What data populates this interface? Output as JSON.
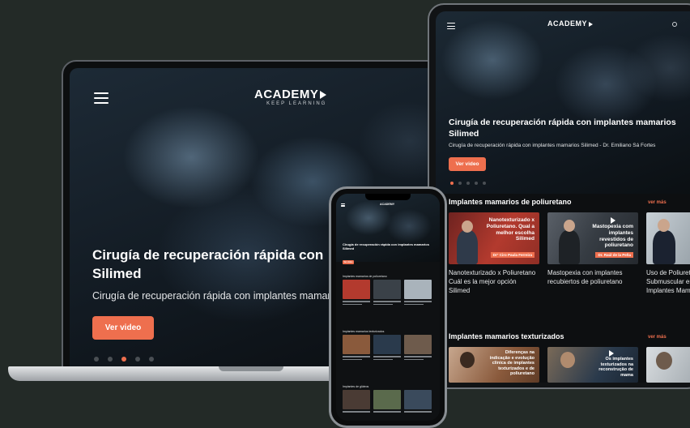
{
  "brand": {
    "logo_text": "ACADEMY",
    "logo_tagline": "KEEP LEARNING",
    "accent_color": "#ee6f4e"
  },
  "laptop": {
    "hero_title": "Cirugía de recuperación rápida con implantes mamarios Silimed",
    "hero_title_line1": "Cirugía de recuperación rápida con",
    "hero_title_line2": "Silimed",
    "hero_subtitle": "Cirugía de recuperación rápida con implantes mamarios",
    "cta_label": "Ver video",
    "carousel": {
      "total": 5,
      "active_index": 2
    }
  },
  "tablet": {
    "hero_title_line1": "Cirugía de recuperación rápida con implantes mamarios",
    "hero_title_line2": "Silimed",
    "hero_subtitle": "Cirugía de recuperación rápida con implantes mamarios Silimed - Dr. Emiliano Sá Fortes",
    "cta_label": "Ver video",
    "carousel": {
      "total": 5,
      "active_index": 0
    },
    "sections": [
      {
        "title": "Implantes mamarios de poliuretano",
        "see_more": "ver más",
        "cards": [
          {
            "caption": "Nanotexturizado x Poliuretano Cuál es la mejor opción Silimed",
            "thumb_text": "Nanotexturizado x Poliuretano. Qual a melhor escolha Silimed",
            "tag": "Dr° Ciro Paula Ferreira",
            "bg": "#b33a2e"
          },
          {
            "caption": "Mastopexia con implantes recubiertos de poliuretano",
            "thumb_text": "Mastopexia com implantes revestidos de poliuretano",
            "tag": "Dr. Raúl de la Peña",
            "bg": "#3a4148"
          },
          {
            "caption": "Uso de Poliuretano Submuscular en Implantes Mamarios",
            "thumb_text": "",
            "tag": "",
            "bg": "#a9b3bb"
          }
        ]
      },
      {
        "title": "Implantes mamarios texturizados",
        "see_more": "ver más",
        "cards": [
          {
            "caption": "",
            "thumb_text": "Diferenças na indicação e evolução clínica de implantes texturizados e de poliuretano",
            "tag": "",
            "bg": "#8a5a3c"
          },
          {
            "caption": "",
            "thumb_text": "Os implantes texturizados na reconstrução de mama",
            "tag": "",
            "bg": "#2a3a4c"
          },
          {
            "caption": "",
            "thumb_text": "",
            "tag": "",
            "bg": "#6e5b4c"
          }
        ]
      }
    ]
  },
  "phone": {
    "logo_text": "ACADEMY",
    "hero_title": "Cirugía de recuperación rápida con implantes mamarios Silimed",
    "cta_label": "Ver video",
    "sections": [
      {
        "title": "Implantes mamarios de poliuretano",
        "see_more": "ver más"
      },
      {
        "title": "Implantes mamarios texturizados",
        "see_more": "ver más"
      },
      {
        "title": "Implantes de glúteos",
        "see_more": "ver más"
      }
    ]
  },
  "icons": {
    "menu": "hamburger-menu-icon",
    "search": "search-icon",
    "play": "play-icon"
  }
}
